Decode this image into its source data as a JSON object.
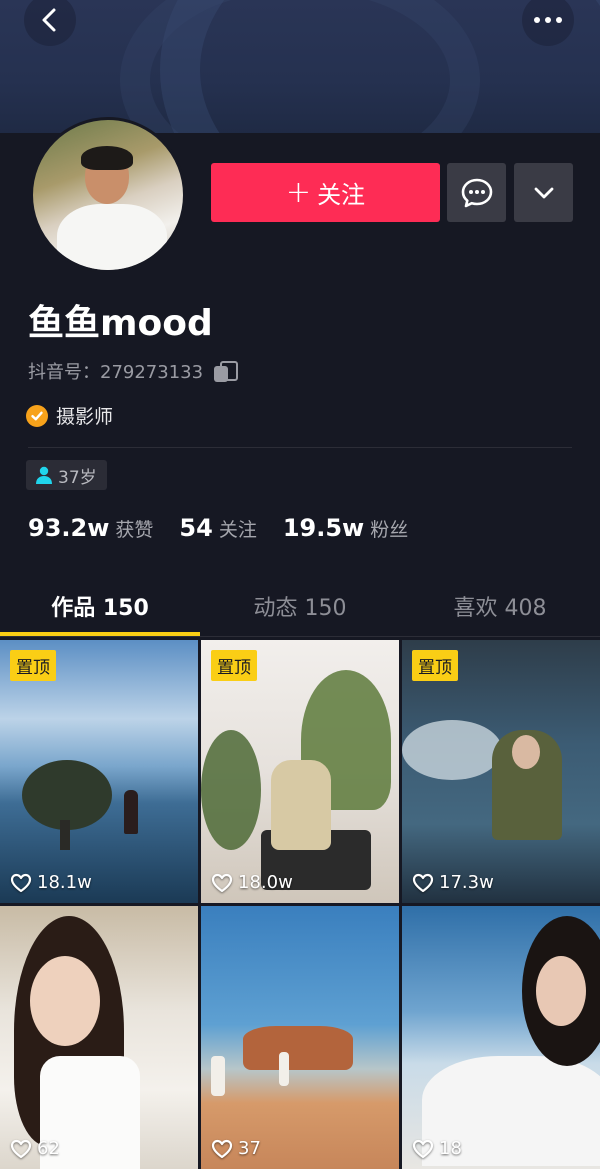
{
  "profile": {
    "nickname": "鱼鱼mood",
    "douyin_id": "抖音号：279273133",
    "verification": "摄影师",
    "age_tag": "37岁"
  },
  "actions": {
    "follow_label": "关注",
    "follow_plus": "+"
  },
  "stats": [
    {
      "value": "93.2w",
      "label": "获赞"
    },
    {
      "value": "54",
      "label": "关注"
    },
    {
      "value": "19.5w",
      "label": "粉丝"
    }
  ],
  "tabs": [
    {
      "label": "作品 150",
      "active": true
    },
    {
      "label": "动态 150",
      "active": false
    },
    {
      "label": "喜欢 408",
      "active": false
    }
  ],
  "videos": [
    {
      "pinned": "置顶",
      "likes": "18.1w"
    },
    {
      "pinned": "置顶",
      "likes": "18.0w"
    },
    {
      "pinned": "置顶",
      "likes": "17.3w"
    },
    {
      "pinned": "",
      "likes": "62"
    },
    {
      "pinned": "",
      "likes": "37"
    },
    {
      "pinned": "",
      "likes": "18"
    }
  ],
  "icons": {
    "back": "chevron-left-icon",
    "more": "more-dots-icon",
    "message": "chat-bubble-icon",
    "dropdown": "chevron-down-icon",
    "copy": "copy-icon",
    "verify": "check-badge-icon",
    "age": "person-icon",
    "like": "heart-icon"
  },
  "colors": {
    "background": "#161823",
    "follow_button": "#fe2c55",
    "tab_indicator": "#face15",
    "pin_badge": "#face15",
    "verify_badge": "#f7a21b",
    "age_icon": "#20d5ec"
  }
}
